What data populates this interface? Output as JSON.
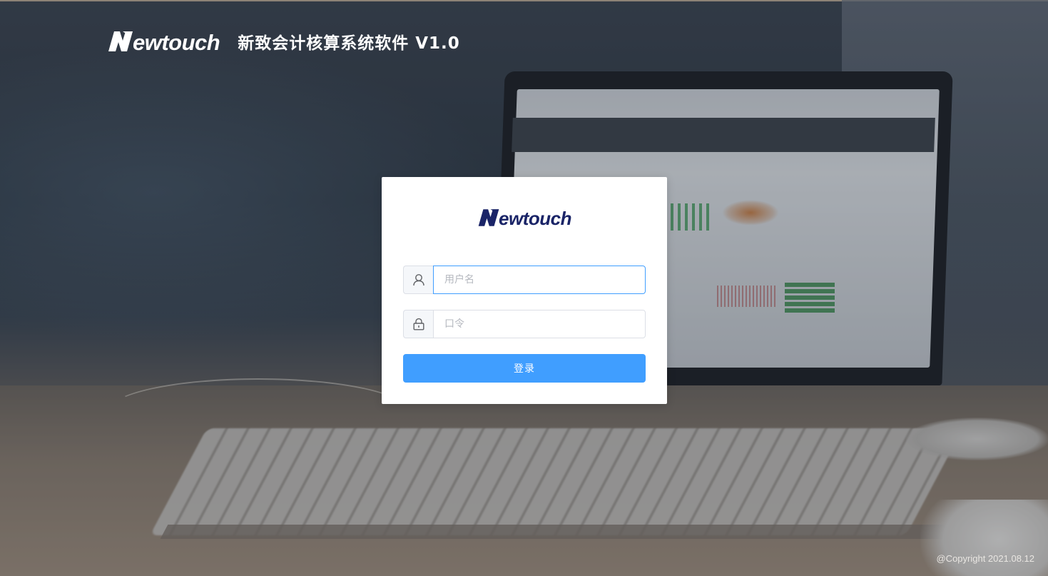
{
  "header": {
    "logo_text": "ewtouch",
    "app_title": "新致会计核算系统软件 V1.0"
  },
  "login": {
    "logo_text": "ewtouch",
    "username_placeholder": "用户名",
    "username_value": "",
    "password_placeholder": "口令",
    "password_value": "",
    "submit_label": "登录"
  },
  "footer": {
    "copyright": "@Copyright 2021.08.12"
  },
  "colors": {
    "brand_navy": "#1a2467",
    "primary": "#409eff",
    "input_border": "#dcdfe6"
  },
  "icons": {
    "username_prefix": "user-icon",
    "password_prefix": "lock-icon"
  }
}
